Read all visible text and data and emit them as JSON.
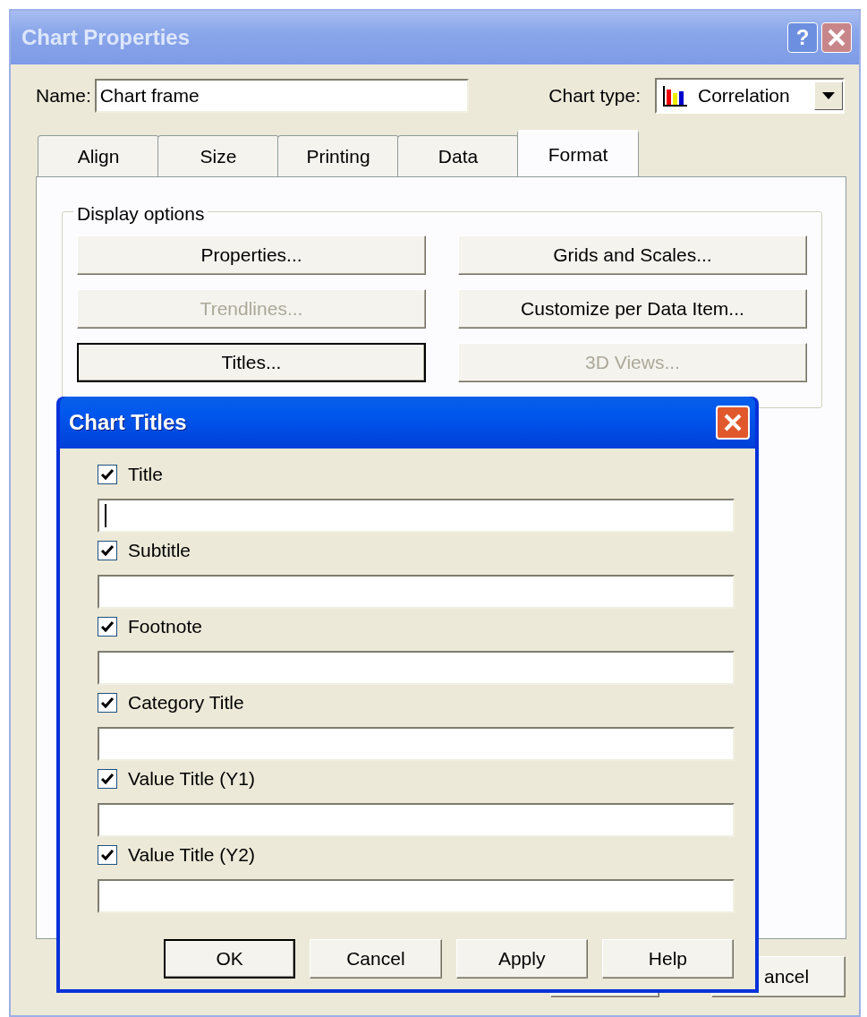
{
  "window": {
    "title": "Chart Properties",
    "help_glyph": "?"
  },
  "name_field": {
    "label": "Name:",
    "value": "Chart frame"
  },
  "chart_type": {
    "label": "Chart type:",
    "value": "Correlation"
  },
  "tabs": [
    {
      "label": "Align",
      "selected": false
    },
    {
      "label": "Size",
      "selected": false
    },
    {
      "label": "Printing",
      "selected": false
    },
    {
      "label": "Data",
      "selected": false
    },
    {
      "label": "Format",
      "selected": true
    }
  ],
  "display_options": {
    "title": "Display options",
    "buttons": [
      {
        "label": "Properties...",
        "disabled": false,
        "focused": false
      },
      {
        "label": "Grids and Scales...",
        "disabled": false,
        "focused": false
      },
      {
        "label": "Trendlines...",
        "disabled": true,
        "focused": false
      },
      {
        "label": "Customize per Data Item...",
        "disabled": false,
        "focused": false
      },
      {
        "label": "Titles...",
        "disabled": false,
        "focused": true
      },
      {
        "label": "3D Views...",
        "disabled": true,
        "focused": false
      }
    ]
  },
  "footer_buttons": [
    {
      "label": "ancel"
    }
  ],
  "dialog": {
    "title": "Chart Titles",
    "fields": [
      {
        "label": "Title",
        "checked": true,
        "focused": true
      },
      {
        "label": "Subtitle",
        "checked": true,
        "focused": false
      },
      {
        "label": "Footnote",
        "checked": true,
        "focused": false
      },
      {
        "label": "Category Title",
        "checked": true,
        "focused": false
      },
      {
        "label": "Value Title (Y1)",
        "checked": true,
        "focused": false
      },
      {
        "label": "Value Title (Y2)",
        "checked": true,
        "focused": false
      }
    ],
    "buttons": [
      {
        "label": "OK",
        "default": true
      },
      {
        "label": "Cancel",
        "default": false
      },
      {
        "label": "Apply",
        "default": false
      },
      {
        "label": "Help",
        "default": false
      }
    ]
  }
}
